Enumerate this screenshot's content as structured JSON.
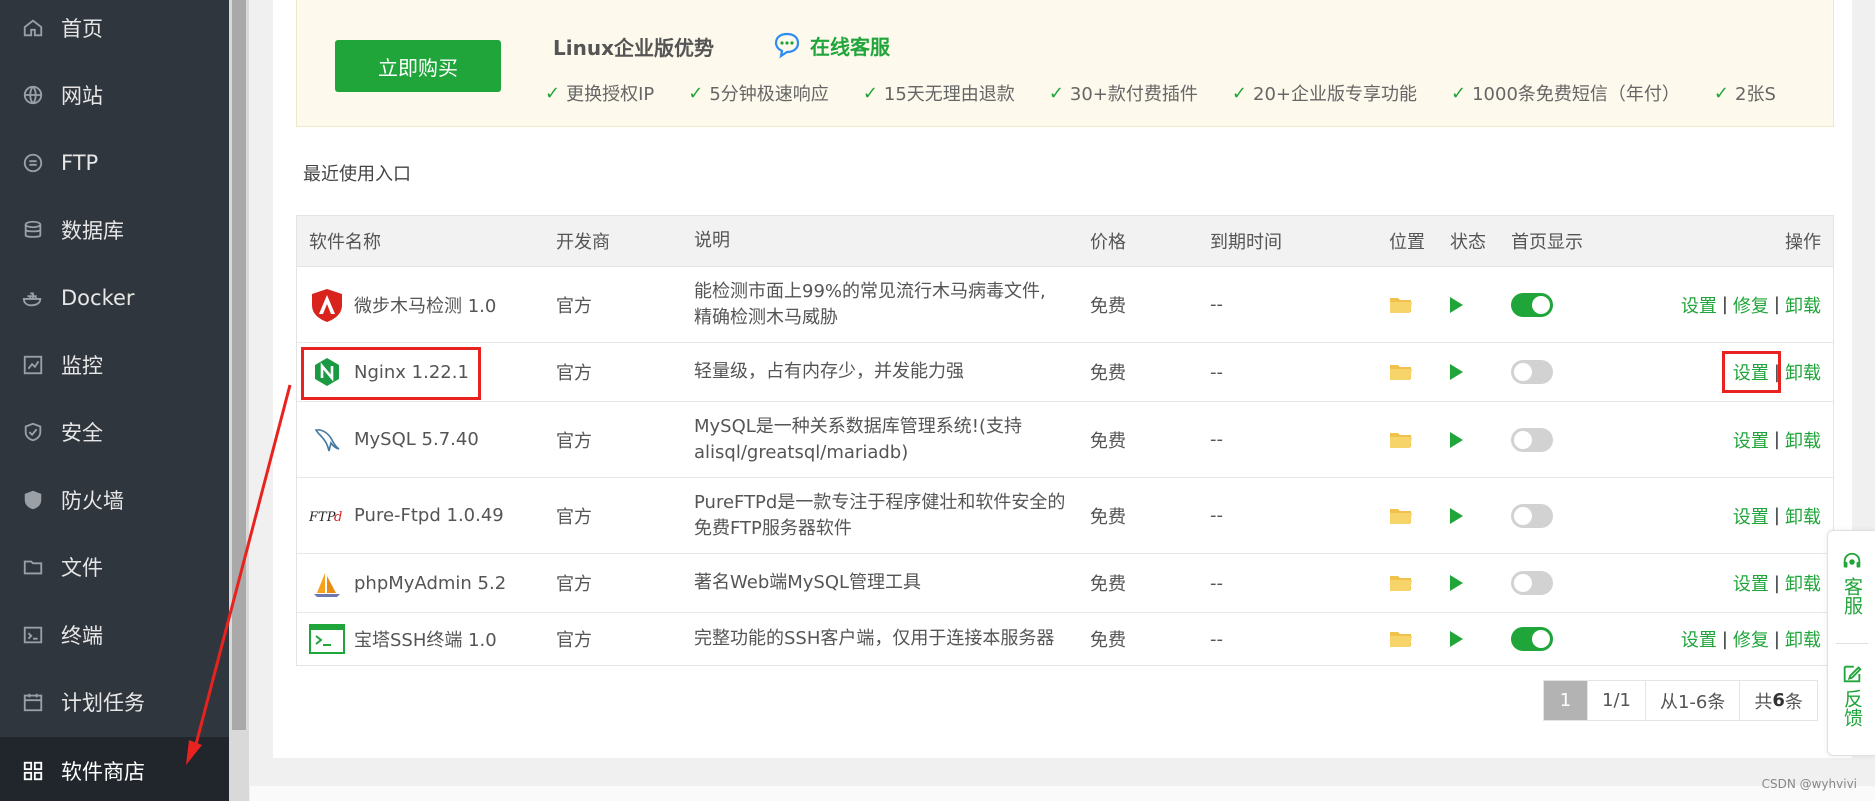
{
  "sidebar": {
    "items": [
      {
        "label": "首页",
        "icon": "home-icon"
      },
      {
        "label": "网站",
        "icon": "globe-icon"
      },
      {
        "label": "FTP",
        "icon": "ftp-icon"
      },
      {
        "label": "数据库",
        "icon": "database-icon"
      },
      {
        "label": "Docker",
        "icon": "docker-icon"
      },
      {
        "label": "监控",
        "icon": "monitor-icon"
      },
      {
        "label": "安全",
        "icon": "shield-icon"
      },
      {
        "label": "防火墙",
        "icon": "firewall-icon"
      },
      {
        "label": "文件",
        "icon": "folder-icon"
      },
      {
        "label": "终端",
        "icon": "terminal-icon"
      },
      {
        "label": "计划任务",
        "icon": "calendar-icon"
      },
      {
        "label": "软件商店",
        "icon": "grid-icon",
        "active": true
      }
    ]
  },
  "promo": {
    "buy_label": "立即购买",
    "title": "Linux企业版优势",
    "online_service": "在线客服",
    "features": [
      "更换授权IP",
      "5分钟极速响应",
      "15天无理由退款",
      "30+款付费插件",
      "20+企业版专享功能",
      "1000条免费短信（年付）",
      "2张S"
    ]
  },
  "recent": {
    "title": "最近使用入口"
  },
  "table": {
    "headers": {
      "name": "软件名称",
      "developer": "开发商",
      "description": "说明",
      "price": "价格",
      "expiry": "到期时间",
      "location": "位置",
      "status": "状态",
      "homepage": "首页显示",
      "ops": "操作"
    },
    "rows": [
      {
        "name": "微步木马检测 1.0",
        "icon": "shield-red-icon",
        "developer": "官方",
        "desc1": "能检测市面上99%的常见流行木马病毒文件,",
        "desc2": "精确检测木马威胁",
        "price": "免费",
        "expiry": "--",
        "home_on": true,
        "ops": [
          "设置",
          "修复",
          "卸载"
        ]
      },
      {
        "name": "Nginx 1.22.1",
        "icon": "nginx-icon",
        "developer": "官方",
        "desc1": "轻量级，占有内存少，并发能力强",
        "desc2": "",
        "price": "免费",
        "expiry": "--",
        "home_on": false,
        "ops": [
          "设置",
          "卸载"
        ]
      },
      {
        "name": "MySQL 5.7.40",
        "icon": "mysql-icon",
        "developer": "官方",
        "desc1": "MySQL是一种关系数据库管理系统!(支持",
        "desc2": "alisql/greatsql/mariadb)",
        "price": "免费",
        "expiry": "--",
        "home_on": false,
        "ops": [
          "设置",
          "卸载"
        ]
      },
      {
        "name": "Pure-Ftpd 1.0.49",
        "icon": "ftpd-icon",
        "developer": "官方",
        "desc1": "PureFTPd是一款专注于程序健壮和软件安全的",
        "desc2": "免费FTP服务器软件",
        "price": "免费",
        "expiry": "--",
        "home_on": false,
        "ops": [
          "设置",
          "卸载"
        ]
      },
      {
        "name": "phpMyAdmin 5.2",
        "icon": "phpmyadmin-icon",
        "developer": "官方",
        "desc1": "著名Web端MySQL管理工具",
        "desc2": "",
        "price": "免费",
        "expiry": "--",
        "home_on": false,
        "ops": [
          "设置",
          "卸载"
        ]
      },
      {
        "name": "宝塔SSH终端 1.0",
        "icon": "ssh-terminal-icon",
        "developer": "官方",
        "desc1": "完整功能的SSH客户端，仅用于连接本服务器",
        "desc2": "",
        "price": "免费",
        "expiry": "--",
        "home_on": true,
        "ops": [
          "设置",
          "修复",
          "卸载"
        ]
      }
    ]
  },
  "pager": {
    "current": "1",
    "pages": "1/1",
    "range": "从1-6条",
    "total_prefix": "共",
    "total_num": "6",
    "total_suffix": "条"
  },
  "float": {
    "service": "客服",
    "feedback": "反馈"
  },
  "watermark": "CSDN @wyhvivi",
  "colors": {
    "accent": "#20a53a",
    "sidebar_bg": "#30363d",
    "annotation_red": "#e8231f"
  }
}
